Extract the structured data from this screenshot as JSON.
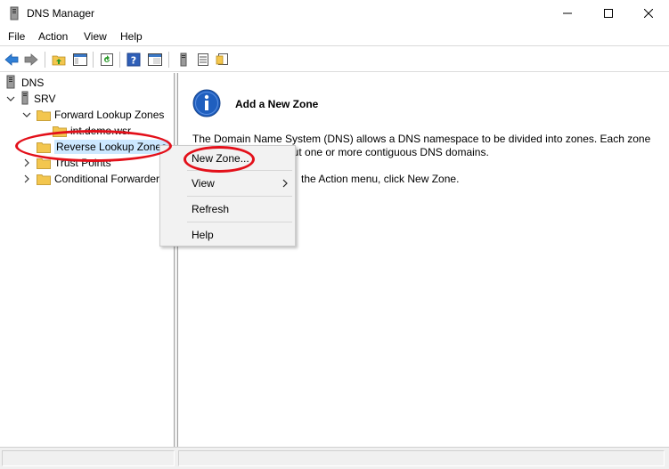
{
  "window": {
    "title": "DNS Manager",
    "controls": {
      "minimize": "—",
      "maximize": "☐",
      "close": "✕"
    }
  },
  "menubar": {
    "items": [
      "File",
      "Action",
      "View",
      "Help"
    ]
  },
  "toolbar": {
    "icons": [
      "back-arrow-icon",
      "forward-arrow-icon",
      "up-folder-icon",
      "show-hide-tree-icon",
      "refresh-icon",
      "help-icon",
      "console-icon",
      "server-icon",
      "list-icon",
      "properties-icon"
    ]
  },
  "tree": {
    "root": "DNS",
    "server": "SRV",
    "forward": "Forward Lookup Zones",
    "forward_child": "int.demo.wsr",
    "reverse": "Reverse Lookup Zones",
    "trust": "Trust Points",
    "conditional": "Conditional Forwarders"
  },
  "content": {
    "heading": "Add a New Zone",
    "line1": "The Domain Name System (DNS) allows a DNS namespace to be divided into zones. Each zone",
    "line2": "out one or more contiguous DNS domains.",
    "line3": "the Action menu, click New Zone."
  },
  "context_menu": {
    "new_zone": "New Zone...",
    "view": "View",
    "refresh": "Refresh",
    "help": "Help",
    "submenu_arrow": "›"
  },
  "colors": {
    "annotation": "#e3101a",
    "selection": "#cce8ff",
    "folder": "#f3c64e",
    "info_blue": "#1f5fbf"
  }
}
